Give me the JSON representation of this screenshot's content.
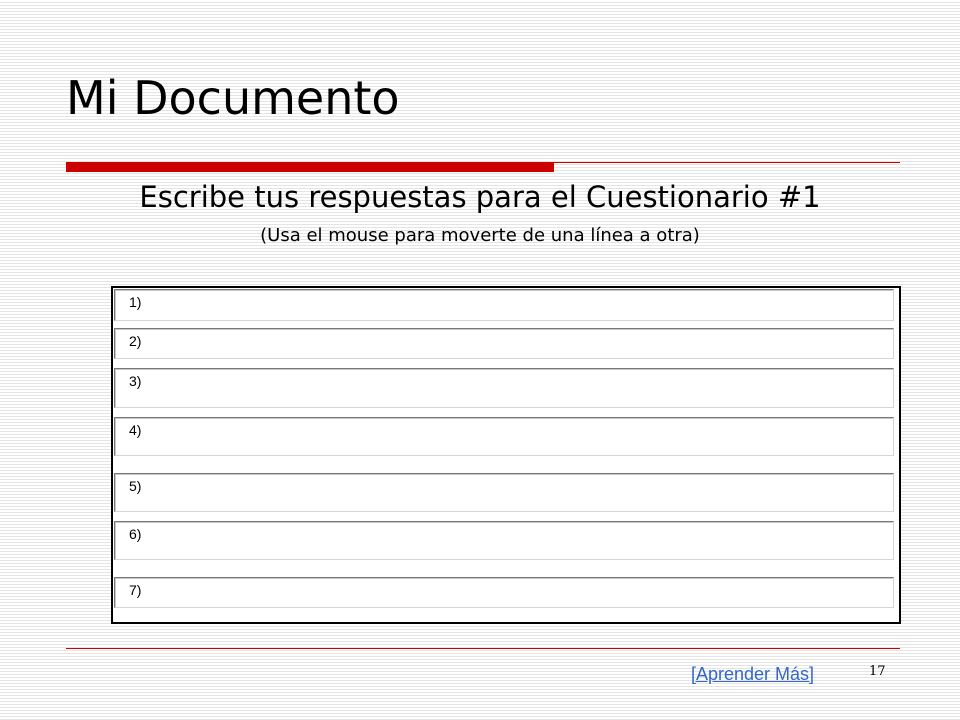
{
  "slide": {
    "title": "Mi Documento",
    "subtitle": "Escribe tus respuestas para el Cuestionario #1",
    "instructions": "(Usa el mouse para moverte de una línea a otra)",
    "answers": [
      "1)",
      "2)",
      "3)",
      "4)",
      "5)",
      "6)",
      "7)"
    ],
    "link_label": "[Aprender Más]",
    "page_number": "17"
  },
  "colors": {
    "accent_rule": "#cc0000",
    "link": "#3366cc"
  }
}
